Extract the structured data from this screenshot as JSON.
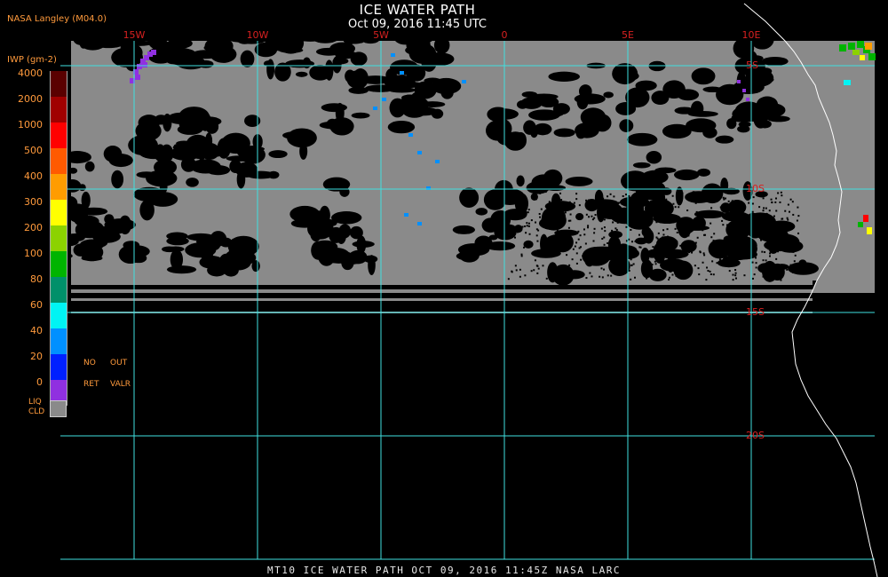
{
  "title": "ICE WATER PATH",
  "subtitle": "Oct 09, 2016 11:45 UTC",
  "credit": "NASA Langley (M04.0)",
  "footer": "MT10  ICE WATER PATH   OCT 09, 2016 11:45Z   NASA LARC",
  "legend": {
    "unit": "IWP (gm-2)",
    "levels": [
      {
        "label": "4000",
        "color": "#5a0000"
      },
      {
        "label": "2000",
        "color": "#a00000"
      },
      {
        "label": "1000",
        "color": "#ff0000"
      },
      {
        "label": "500",
        "color": "#ff5a00"
      },
      {
        "label": "400",
        "color": "#ff9c00"
      },
      {
        "label": "300",
        "color": "#ffff00"
      },
      {
        "label": "200",
        "color": "#8cd200"
      },
      {
        "label": "100",
        "color": "#00b400"
      },
      {
        "label": "80",
        "color": "#00906a"
      },
      {
        "label": "60",
        "color": "#00f4f4"
      },
      {
        "label": "40",
        "color": "#0090ff"
      },
      {
        "label": "20",
        "color": "#0020ff"
      },
      {
        "label": "0",
        "color": "#9030e0"
      }
    ],
    "no_ret": {
      "line1": "NO",
      "line2": "RET"
    },
    "out_valr": {
      "line1": "OUT",
      "line2": "VALR"
    },
    "liq": {
      "line1": "LIQ",
      "line2": "CLD"
    }
  },
  "grid": {
    "longitudes": [
      {
        "label": "15W",
        "value": -15
      },
      {
        "label": "10W",
        "value": -10
      },
      {
        "label": "5W",
        "value": -5
      },
      {
        "label": "0",
        "value": 0
      },
      {
        "label": "5E",
        "value": 5
      },
      {
        "label": "10E",
        "value": 10
      }
    ],
    "latitudes": [
      {
        "label": "5S",
        "value": -5
      },
      {
        "label": "10S",
        "value": -10
      },
      {
        "label": "15S",
        "value": -15
      },
      {
        "label": "20S",
        "value": -20
      }
    ]
  },
  "colors": {
    "grid": "#40e0e0",
    "tick_label": "#d82020",
    "liquid_cloud": "#8a8a8a",
    "coastline": "#ffffff",
    "background": "#000000"
  }
}
